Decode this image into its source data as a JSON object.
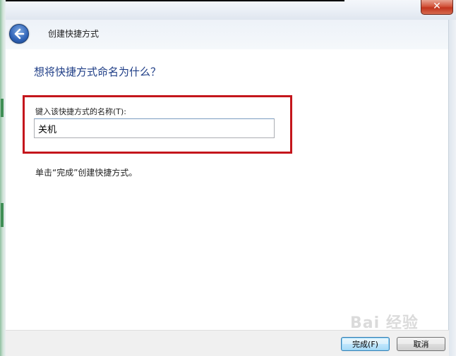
{
  "window": {
    "title": "创建快捷方式",
    "close_glyph": "✕"
  },
  "page": {
    "main_instruction": "想将快捷方式命名为什么？",
    "field_label": "键入该快捷方式的名称(T):",
    "name_value": "关机",
    "hint": "单击“完成”创建快捷方式。"
  },
  "footer": {
    "finish_label": "完成(F)",
    "cancel_label": "取消"
  },
  "watermark": "Bai 经验",
  "colors": {
    "instruction": "#1e3d86",
    "highlight": "#c4161c",
    "back_button": "#2f63b8",
    "close_button": "#c2341d"
  },
  "icons": {
    "back": "back-arrow-icon",
    "close": "close-icon"
  }
}
